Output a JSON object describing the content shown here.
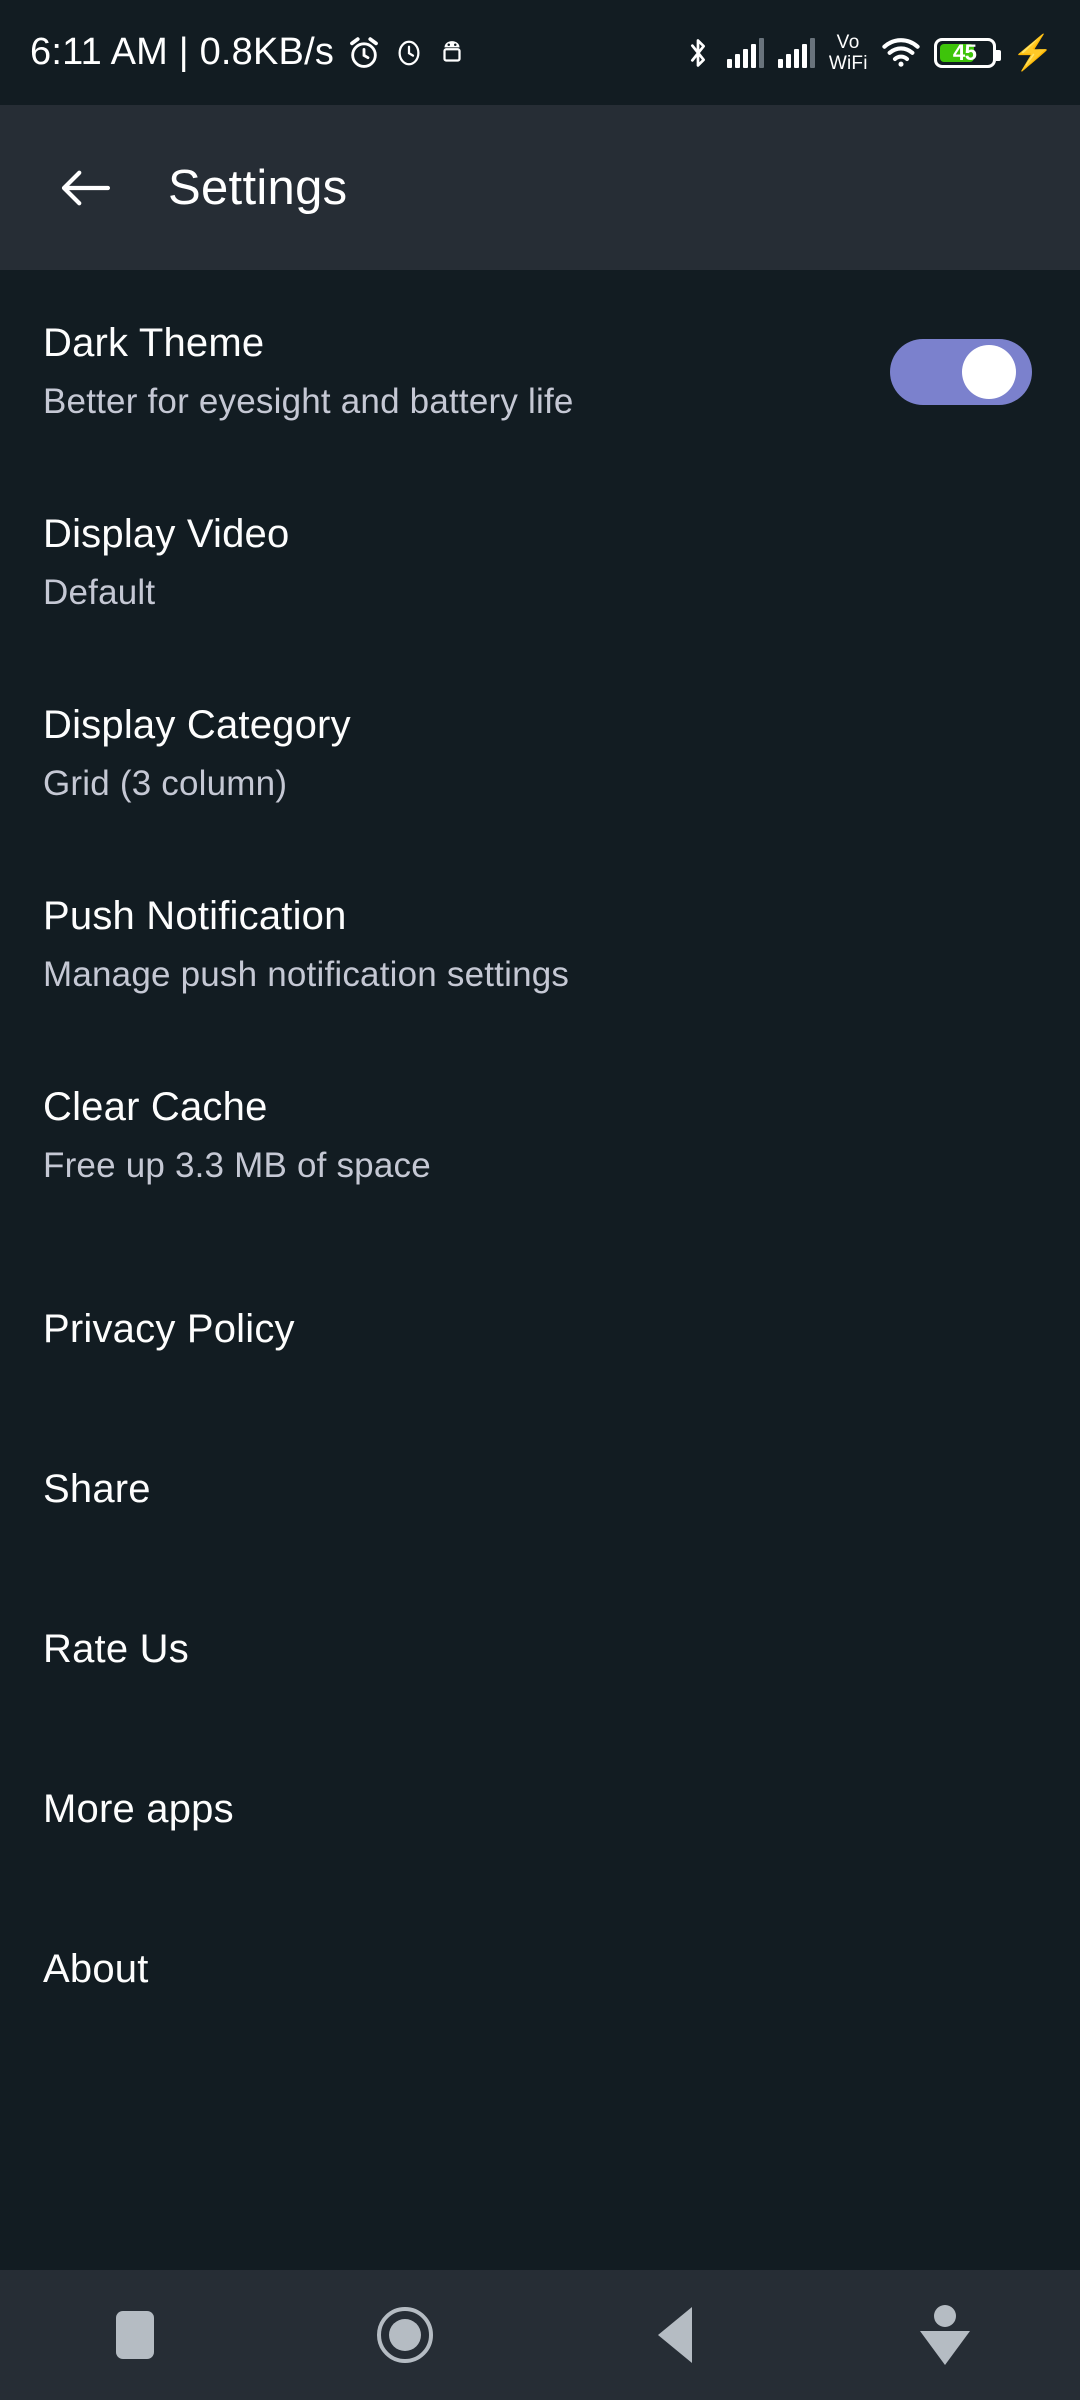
{
  "status_bar": {
    "clock": "6:11 AM | 0.8KB/s",
    "icons": [
      "alarm-clock-icon",
      "clock-icon",
      "android-robot-icon",
      "bluetooth-icon",
      "signal-bars-icon",
      "signal-bars-icon",
      "volte-wifi-icon",
      "wifi-icon",
      "battery-icon",
      "charging-bolt-icon"
    ],
    "volte_line1": "Vo",
    "volte_line2": "WiFi",
    "battery_level": "45",
    "colors": {
      "battery_fill": "#3ec40a",
      "status_bar_bg": "#121c22",
      "icon": "#ffffff"
    }
  },
  "app_bar": {
    "back_icon": "arrow-left-icon",
    "title": "Settings",
    "bg": "#262d35"
  },
  "settings": {
    "items": [
      {
        "title": "Dark Theme",
        "subtitle": "Better for eyesight and battery life",
        "control": "toggle",
        "toggle_on": true
      },
      {
        "title": "Display Video",
        "subtitle": "Default",
        "control": "none"
      },
      {
        "title": "Display Category",
        "subtitle": "Grid (3 column)",
        "control": "none"
      },
      {
        "title": "Push Notification",
        "subtitle": "Manage push notification settings",
        "control": "none"
      },
      {
        "title": "Clear Cache",
        "subtitle": "Free up 3.3 MB of space",
        "control": "none"
      },
      {
        "title": "Privacy Policy",
        "subtitle": "",
        "control": "none"
      },
      {
        "title": "Share",
        "subtitle": "",
        "control": "none"
      },
      {
        "title": "Rate Us",
        "subtitle": "",
        "control": "none"
      },
      {
        "title": "More apps",
        "subtitle": "",
        "control": "none"
      },
      {
        "title": "About",
        "subtitle": "",
        "control": "none"
      }
    ],
    "colors": {
      "background": "#121c22",
      "title_text": "#fdfdfd",
      "subtitle_text": "#c5c8d4",
      "toggle_track": "#7b81cd",
      "toggle_thumb": "#ffffff"
    }
  },
  "nav_bar": {
    "buttons": [
      "recents-square-icon",
      "home-circle-icon",
      "back-triangle-icon",
      "hide-navbar-icon"
    ],
    "bg": "#262d35",
    "icon_color": "#b5bcc3"
  }
}
